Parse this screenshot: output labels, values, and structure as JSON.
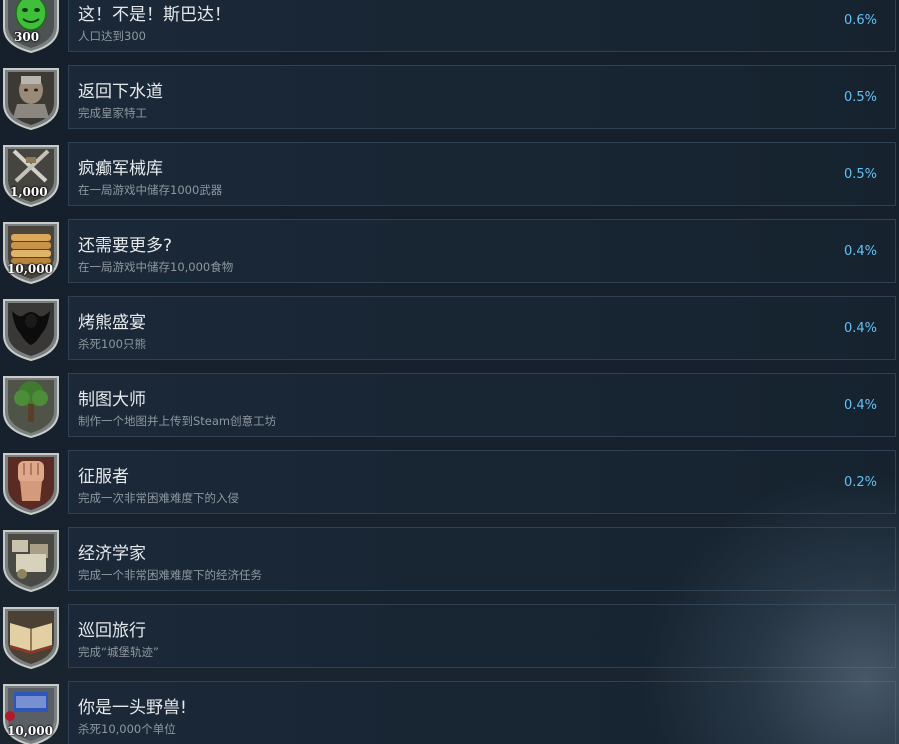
{
  "achievements": [
    {
      "title": "这！不是！斯巴达！",
      "desc": "人口达到300",
      "percent": "0.6%",
      "icon": "green-mask-icon",
      "badge": "300"
    },
    {
      "title": "返回下水道",
      "desc": "完成皇家特工",
      "percent": "0.5%",
      "icon": "knight-helmet-icon",
      "badge": ""
    },
    {
      "title": "疯癫军械库",
      "desc": "在一局游戏中储存1000武器",
      "percent": "0.5%",
      "icon": "crossed-weapons-icon",
      "badge": "1,000"
    },
    {
      "title": "还需要更多?",
      "desc": "在一局游戏中储存10,000食物",
      "percent": "0.4%",
      "icon": "bread-stack-icon",
      "badge": "10,000"
    },
    {
      "title": "烤熊盛宴",
      "desc": "杀死100只熊",
      "percent": "0.4%",
      "icon": "bear-icon",
      "badge": ""
    },
    {
      "title": "制图大师",
      "desc": "制作一个地图并上传到Steam创意工坊",
      "percent": "0.4%",
      "icon": "tree-icon",
      "badge": ""
    },
    {
      "title": "征服者",
      "desc": "完成一次非常困难难度下的入侵",
      "percent": "0.2%",
      "icon": "raised-fist-icon",
      "badge": ""
    },
    {
      "title": "经济学家",
      "desc": "完成一个非常困难难度下的经济任务",
      "percent": "",
      "icon": "goods-pile-icon",
      "badge": ""
    },
    {
      "title": "巡回旅行",
      "desc": "完成“城堡轨迹”",
      "percent": "",
      "icon": "open-book-icon",
      "badge": ""
    },
    {
      "title": "你是一头野兽!",
      "desc": "杀死10,000个单位",
      "percent": "",
      "icon": "blue-pennant-icon",
      "badge": "10,000"
    }
  ],
  "colors": {
    "background": "#1b2838",
    "title": "#e6e9ec",
    "description": "#8f98a0",
    "percent": "#66c0f4"
  }
}
